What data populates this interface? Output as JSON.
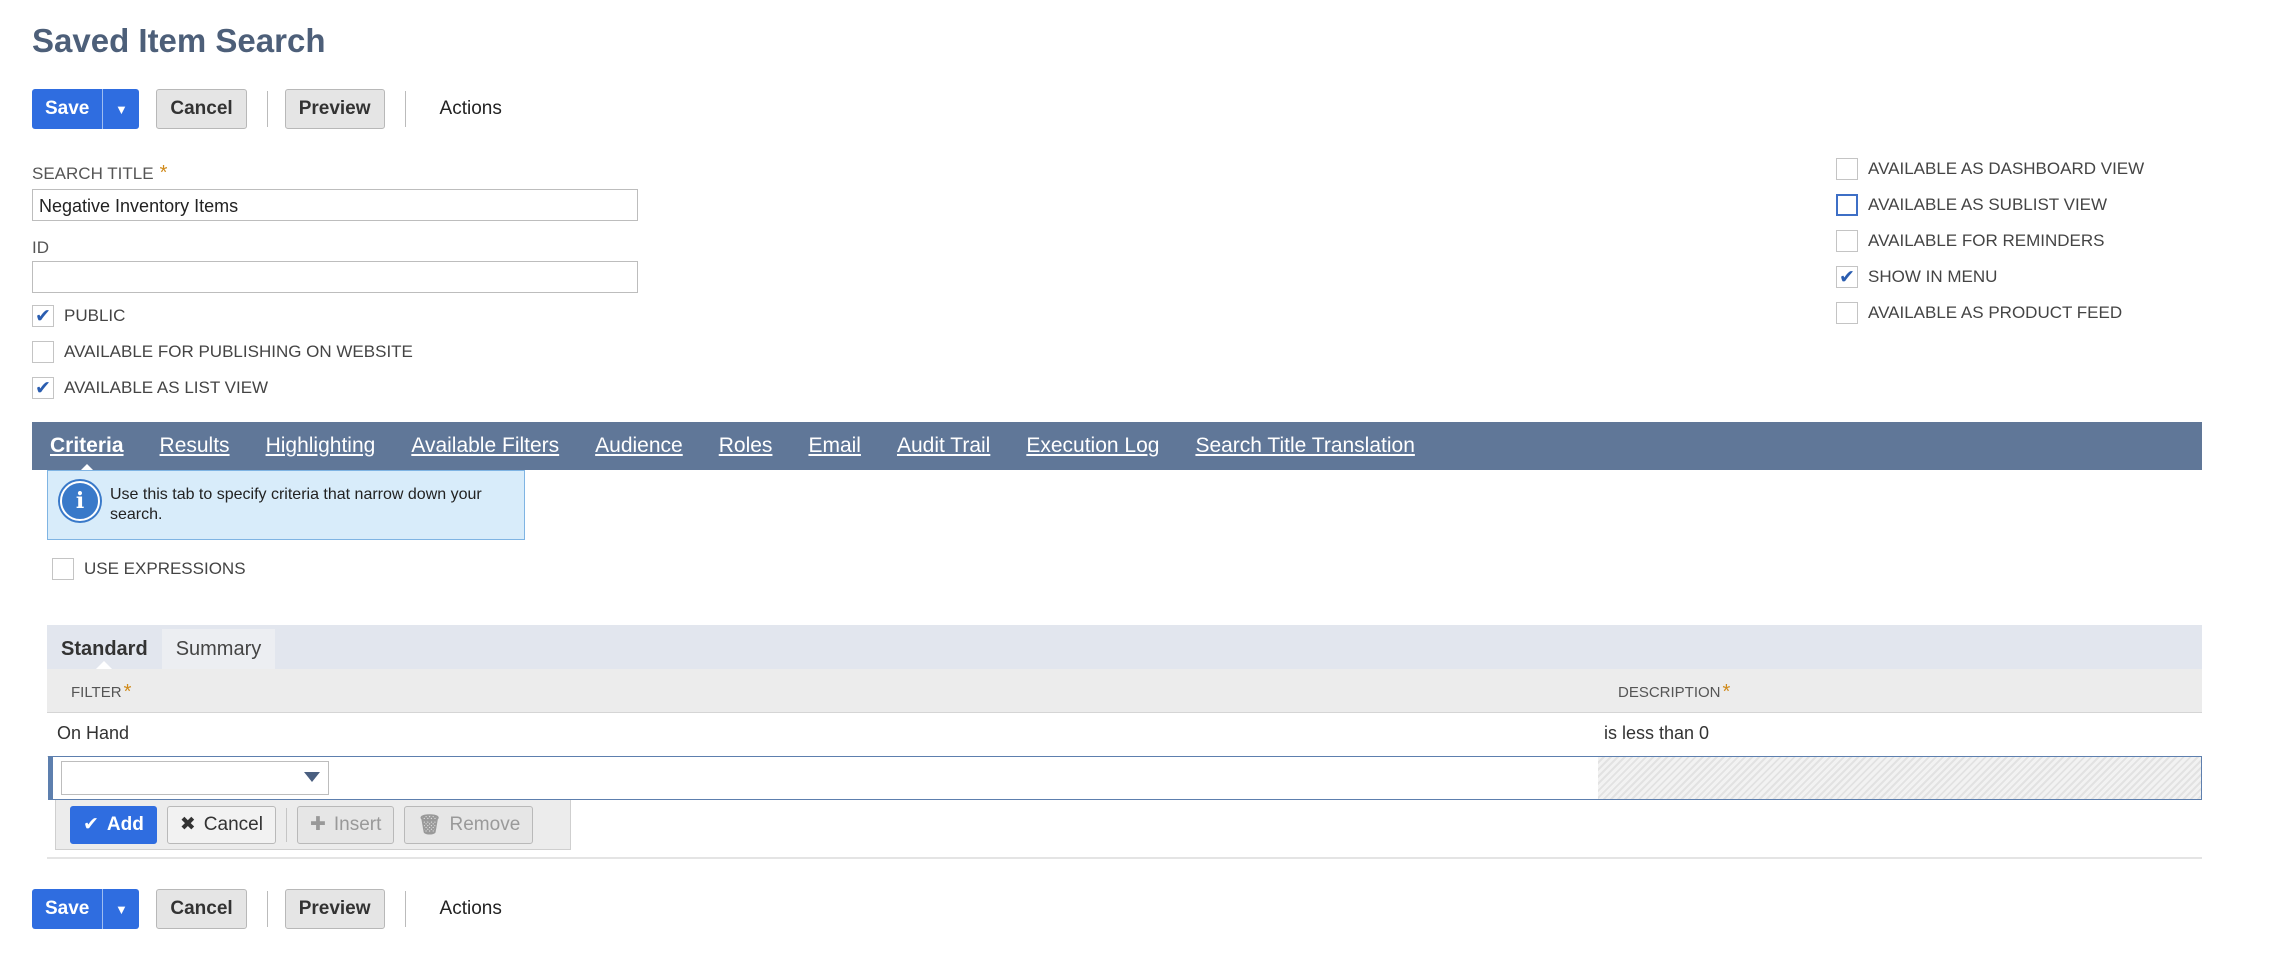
{
  "page": {
    "title": "Saved Item Search"
  },
  "toolbar": {
    "save": "Save",
    "cancel": "Cancel",
    "preview": "Preview",
    "actions": "Actions"
  },
  "fields": {
    "search_title_label": "SEARCH TITLE",
    "search_title_value": "Negative Inventory Items",
    "id_label": "ID",
    "id_value": "",
    "required_mark": "*"
  },
  "left_checkboxes": [
    {
      "label": "PUBLIC",
      "checked": true
    },
    {
      "label": "AVAILABLE FOR PUBLISHING ON WEBSITE",
      "checked": false
    },
    {
      "label": "AVAILABLE AS LIST VIEW",
      "checked": true
    }
  ],
  "right_checkboxes": [
    {
      "label": "AVAILABLE AS DASHBOARD VIEW",
      "checked": false
    },
    {
      "label": "AVAILABLE AS SUBLIST VIEW",
      "checked": false
    },
    {
      "label": "AVAILABLE FOR REMINDERS",
      "checked": false
    },
    {
      "label": "SHOW IN MENU",
      "checked": true
    },
    {
      "label": "AVAILABLE AS PRODUCT FEED",
      "checked": false
    }
  ],
  "tabs": [
    "Criteria",
    "Results",
    "Highlighting",
    "Available Filters",
    "Audience",
    "Roles",
    "Email",
    "Audit Trail",
    "Execution Log",
    "Search Title Translation"
  ],
  "info": {
    "text": "Use this tab to specify criteria that narrow down your search."
  },
  "use_expressions": {
    "label": "USE EXPRESSIONS",
    "checked": false
  },
  "subtabs": [
    "Standard",
    "Summary"
  ],
  "table": {
    "headers": [
      "FILTER",
      "DESCRIPTION"
    ],
    "rows": [
      {
        "filter": "On Hand",
        "description": "is less than 0"
      }
    ]
  },
  "row_actions": {
    "add": "Add",
    "cancel": "Cancel",
    "insert": "Insert",
    "remove": "Remove"
  },
  "colors": {
    "primary": "#2f6de0",
    "tabbar": "#607798",
    "title": "#4d5f79",
    "required": "#d08a1a"
  }
}
